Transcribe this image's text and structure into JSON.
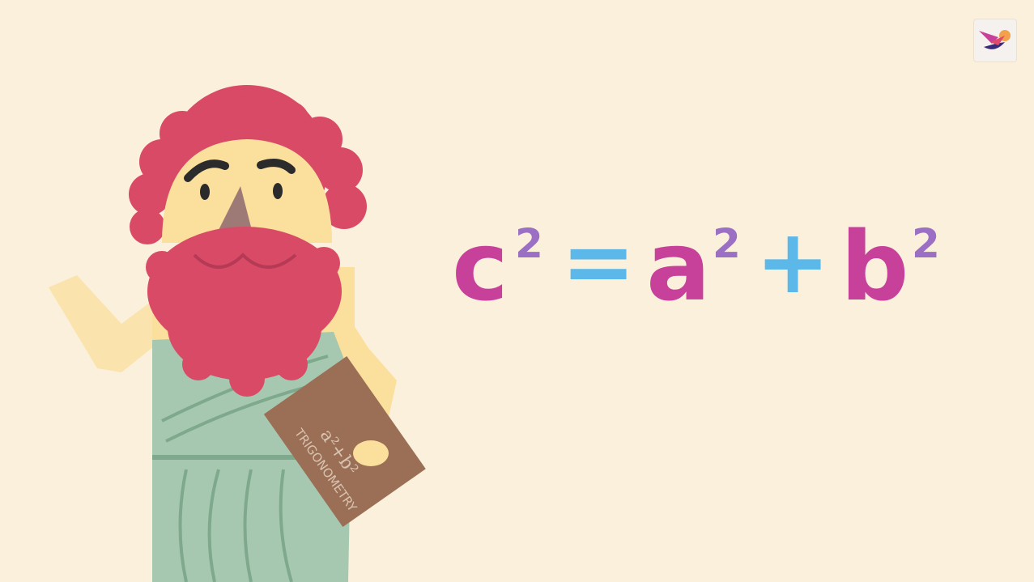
{
  "colors": {
    "background": "#fbf0dc",
    "variable": "#c7419b",
    "exponent": "#9a6fc4",
    "operator": "#5bb8e8",
    "beard": "#d94a67",
    "toga": "#a7c8b0",
    "skin": "#fbdf9d",
    "book": "#9b6f56"
  },
  "equation": {
    "lhs_base": "c",
    "lhs_exp": "2",
    "equals": "=",
    "a_base": "a",
    "a_exp": "2",
    "plus": "+",
    "b_base": "b",
    "b_exp": "2"
  },
  "book": {
    "title": "TRIGONOMETRY",
    "scribble": "a²+b²"
  },
  "logo": {
    "icon": "bird-logo-icon"
  }
}
